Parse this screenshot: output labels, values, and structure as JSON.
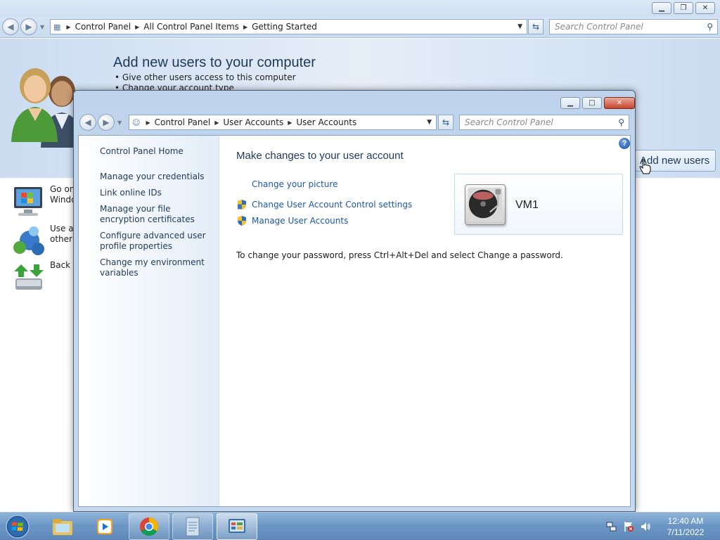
{
  "background_window": {
    "address": {
      "crumbs": [
        "Control Panel",
        "All Control Panel Items",
        "Getting Started"
      ]
    },
    "search_placeholder": "Search Control Panel",
    "heading": "Add new users to your computer",
    "bullets": [
      "• Give other users access to this computer",
      "• Change your account type"
    ],
    "add_users_button": "Add new users",
    "tasks": [
      {
        "line1": "Go on",
        "line2": "Windo"
      },
      {
        "line1": "Use a",
        "line2": "other"
      },
      {
        "line1": "Back u",
        "line2": ""
      }
    ]
  },
  "user_accounts_window": {
    "address": {
      "crumbs": [
        "Control Panel",
        "User Accounts",
        "User Accounts"
      ]
    },
    "search_placeholder": "Search Control Panel",
    "left_pane": {
      "home": "Control Panel Home",
      "links": [
        "Manage your credentials",
        "Link online IDs",
        "Manage your file encryption certificates",
        "Configure advanced user profile properties",
        "Change my environment variables"
      ]
    },
    "main": {
      "heading": "Make changes to your user account",
      "links": [
        {
          "label": "Change your picture",
          "icon": "none"
        },
        {
          "label": "Change User Account Control settings",
          "icon": "uac-shield-icon"
        },
        {
          "label": "Manage User Accounts",
          "icon": "uac-shield-icon"
        }
      ],
      "password_note": "To change your password, press Ctrl+Alt+Del and select Change a password.",
      "account": {
        "name": "VM1",
        "picture": "turntable"
      }
    }
  },
  "taskbar": {
    "apps": [
      "windows-explorer",
      "media-player",
      "chrome",
      "notepad-document",
      "control-panel"
    ],
    "clock": {
      "time": "12:40 AM",
      "date": "7/11/2022"
    }
  },
  "colors": {
    "heading_blue": "#1e395b",
    "link_blue": "#1b58a8",
    "taskbar": "#6d98c6"
  }
}
